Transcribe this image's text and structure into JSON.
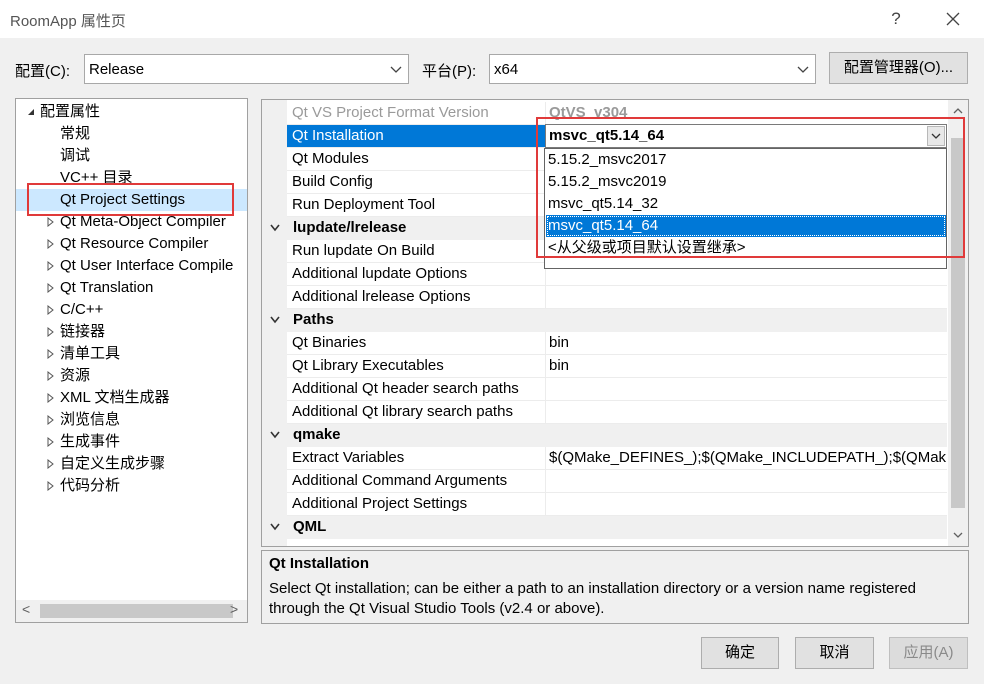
{
  "window": {
    "title": "RoomApp 属性页",
    "help_glyph": "?",
    "close_glyph": "✕"
  },
  "config_row": {
    "config_label": "配置(C):",
    "config_value": "Release",
    "platform_label": "平台(P):",
    "platform_value": "x64",
    "manager_button": "配置管理器(O)..."
  },
  "tree": {
    "items": [
      {
        "label": "配置属性",
        "expander": "expanded"
      },
      {
        "label": "常规",
        "expander": "none"
      },
      {
        "label": "调试",
        "expander": "none"
      },
      {
        "label": "VC++ 目录",
        "expander": "none"
      },
      {
        "label": "Qt Project Settings",
        "expander": "none",
        "selected": true
      },
      {
        "label": "Qt Meta-Object Compiler",
        "expander": "collapsed"
      },
      {
        "label": "Qt Resource Compiler",
        "expander": "collapsed"
      },
      {
        "label": "Qt User Interface Compile",
        "expander": "collapsed"
      },
      {
        "label": "Qt Translation",
        "expander": "collapsed"
      },
      {
        "label": "C/C++",
        "expander": "collapsed"
      },
      {
        "label": "链接器",
        "expander": "collapsed"
      },
      {
        "label": "清单工具",
        "expander": "collapsed"
      },
      {
        "label": "资源",
        "expander": "collapsed"
      },
      {
        "label": "XML 文档生成器",
        "expander": "collapsed"
      },
      {
        "label": "浏览信息",
        "expander": "collapsed"
      },
      {
        "label": "生成事件",
        "expander": "collapsed"
      },
      {
        "label": "自定义生成步骤",
        "expander": "collapsed"
      },
      {
        "label": "代码分析",
        "expander": "collapsed"
      }
    ],
    "scroll_left_glyph": "<",
    "scroll_right_glyph": ">"
  },
  "grid": {
    "rows": [
      {
        "type": "prop",
        "name": "Qt VS Project Format Version",
        "value": "QtVS_v304",
        "faded": true
      },
      {
        "type": "prop",
        "name": "Qt Installation",
        "value": "msvc_qt5.14_64",
        "selected": true
      },
      {
        "type": "prop",
        "name": "Qt Modules",
        "value": ""
      },
      {
        "type": "prop",
        "name": "Build Config",
        "value": ""
      },
      {
        "type": "prop",
        "name": "Run Deployment Tool",
        "value": ""
      },
      {
        "type": "cat",
        "name": "lupdate/lrelease"
      },
      {
        "type": "prop",
        "name": "Run lupdate On Build",
        "value": ""
      },
      {
        "type": "prop",
        "name": "Additional lupdate Options",
        "value": ""
      },
      {
        "type": "prop",
        "name": "Additional lrelease Options",
        "value": ""
      },
      {
        "type": "cat",
        "name": "Paths"
      },
      {
        "type": "prop",
        "name": "Qt Binaries",
        "value": "bin"
      },
      {
        "type": "prop",
        "name": "Qt Library Executables",
        "value": "bin"
      },
      {
        "type": "prop",
        "name": "Additional Qt header search paths",
        "value": ""
      },
      {
        "type": "prop",
        "name": "Additional Qt library search paths",
        "value": ""
      },
      {
        "type": "cat",
        "name": "qmake"
      },
      {
        "type": "prop",
        "name": "Extract Variables",
        "value": "$(QMake_DEFINES_);$(QMake_INCLUDEPATH_);$(QMake_LIBS_)"
      },
      {
        "type": "prop",
        "name": "Additional Command Arguments",
        "value": ""
      },
      {
        "type": "prop",
        "name": "Additional Project Settings",
        "value": ""
      },
      {
        "type": "cat",
        "name": "QML"
      }
    ]
  },
  "dropdown": {
    "current": "msvc_qt5.14_64",
    "options": [
      {
        "label": "5.15.2_msvc2017"
      },
      {
        "label": "5.15.2_msvc2019"
      },
      {
        "label": "msvc_qt5.14_32"
      },
      {
        "label": "msvc_qt5.14_64",
        "highlighted": true
      },
      {
        "label": "<从父级或项目默认设置继承>"
      }
    ]
  },
  "description": {
    "title": "Qt Installation",
    "text": "Select Qt installation; can be either a path to an installation directory or a version name registered through the Qt Visual Studio Tools (v2.4 or above)."
  },
  "footer": {
    "ok": "确定",
    "cancel": "取消",
    "apply": "应用(A)"
  },
  "colors": {
    "selection": "#0078d7",
    "tree_selection": "#cce8ff",
    "annotation_red": "#e03a3a"
  }
}
